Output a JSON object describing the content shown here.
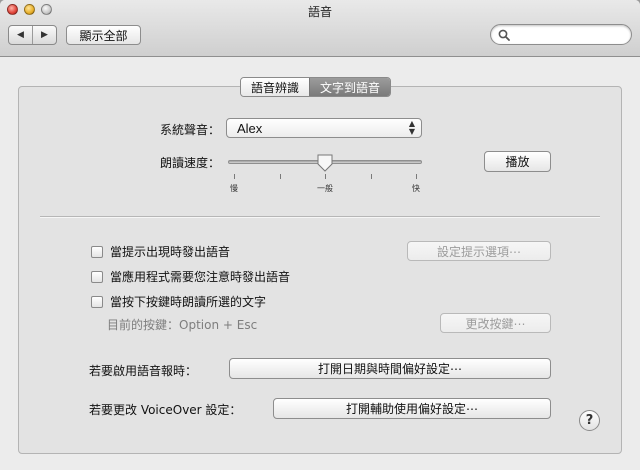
{
  "window": {
    "title": "語音"
  },
  "toolbar": {
    "show_all_label": "顯示全部",
    "search_placeholder": ""
  },
  "tabs": [
    {
      "label": "語音辨識",
      "active": false
    },
    {
      "label": "文字到語音",
      "active": true
    }
  ],
  "voice": {
    "label": "系統聲音：",
    "selected": "Alex"
  },
  "rate": {
    "label": "朗讀速度：",
    "slow_label": "慢",
    "normal_label": "一般",
    "fast_label": "快",
    "value_fraction": 0.5,
    "play_label": "播放"
  },
  "options": {
    "alert_label": "當提示出現時發出語音",
    "alert_checked": false,
    "alert_options_button": "設定提示選項⋯",
    "attention_label": "當應用程式需要您注意時發出語音",
    "attention_checked": false,
    "key_label": "當按下按鍵時朗讀所選的文字",
    "key_checked": false,
    "current_key_label": "目前的按鍵：Option + Esc",
    "change_key_button": "更改按鍵⋯"
  },
  "announce": {
    "label": "若要啟用語音報時：",
    "button": "打開日期與時間偏好設定⋯"
  },
  "voiceover": {
    "label": "若要更改 VoiceOver 設定：",
    "button": "打開輔助使用偏好設定⋯"
  },
  "help": {
    "label": "?"
  },
  "colors": {
    "active_tab": "#858585",
    "window_bg": "#ececec",
    "panel_bg": "#e3e3e3"
  }
}
